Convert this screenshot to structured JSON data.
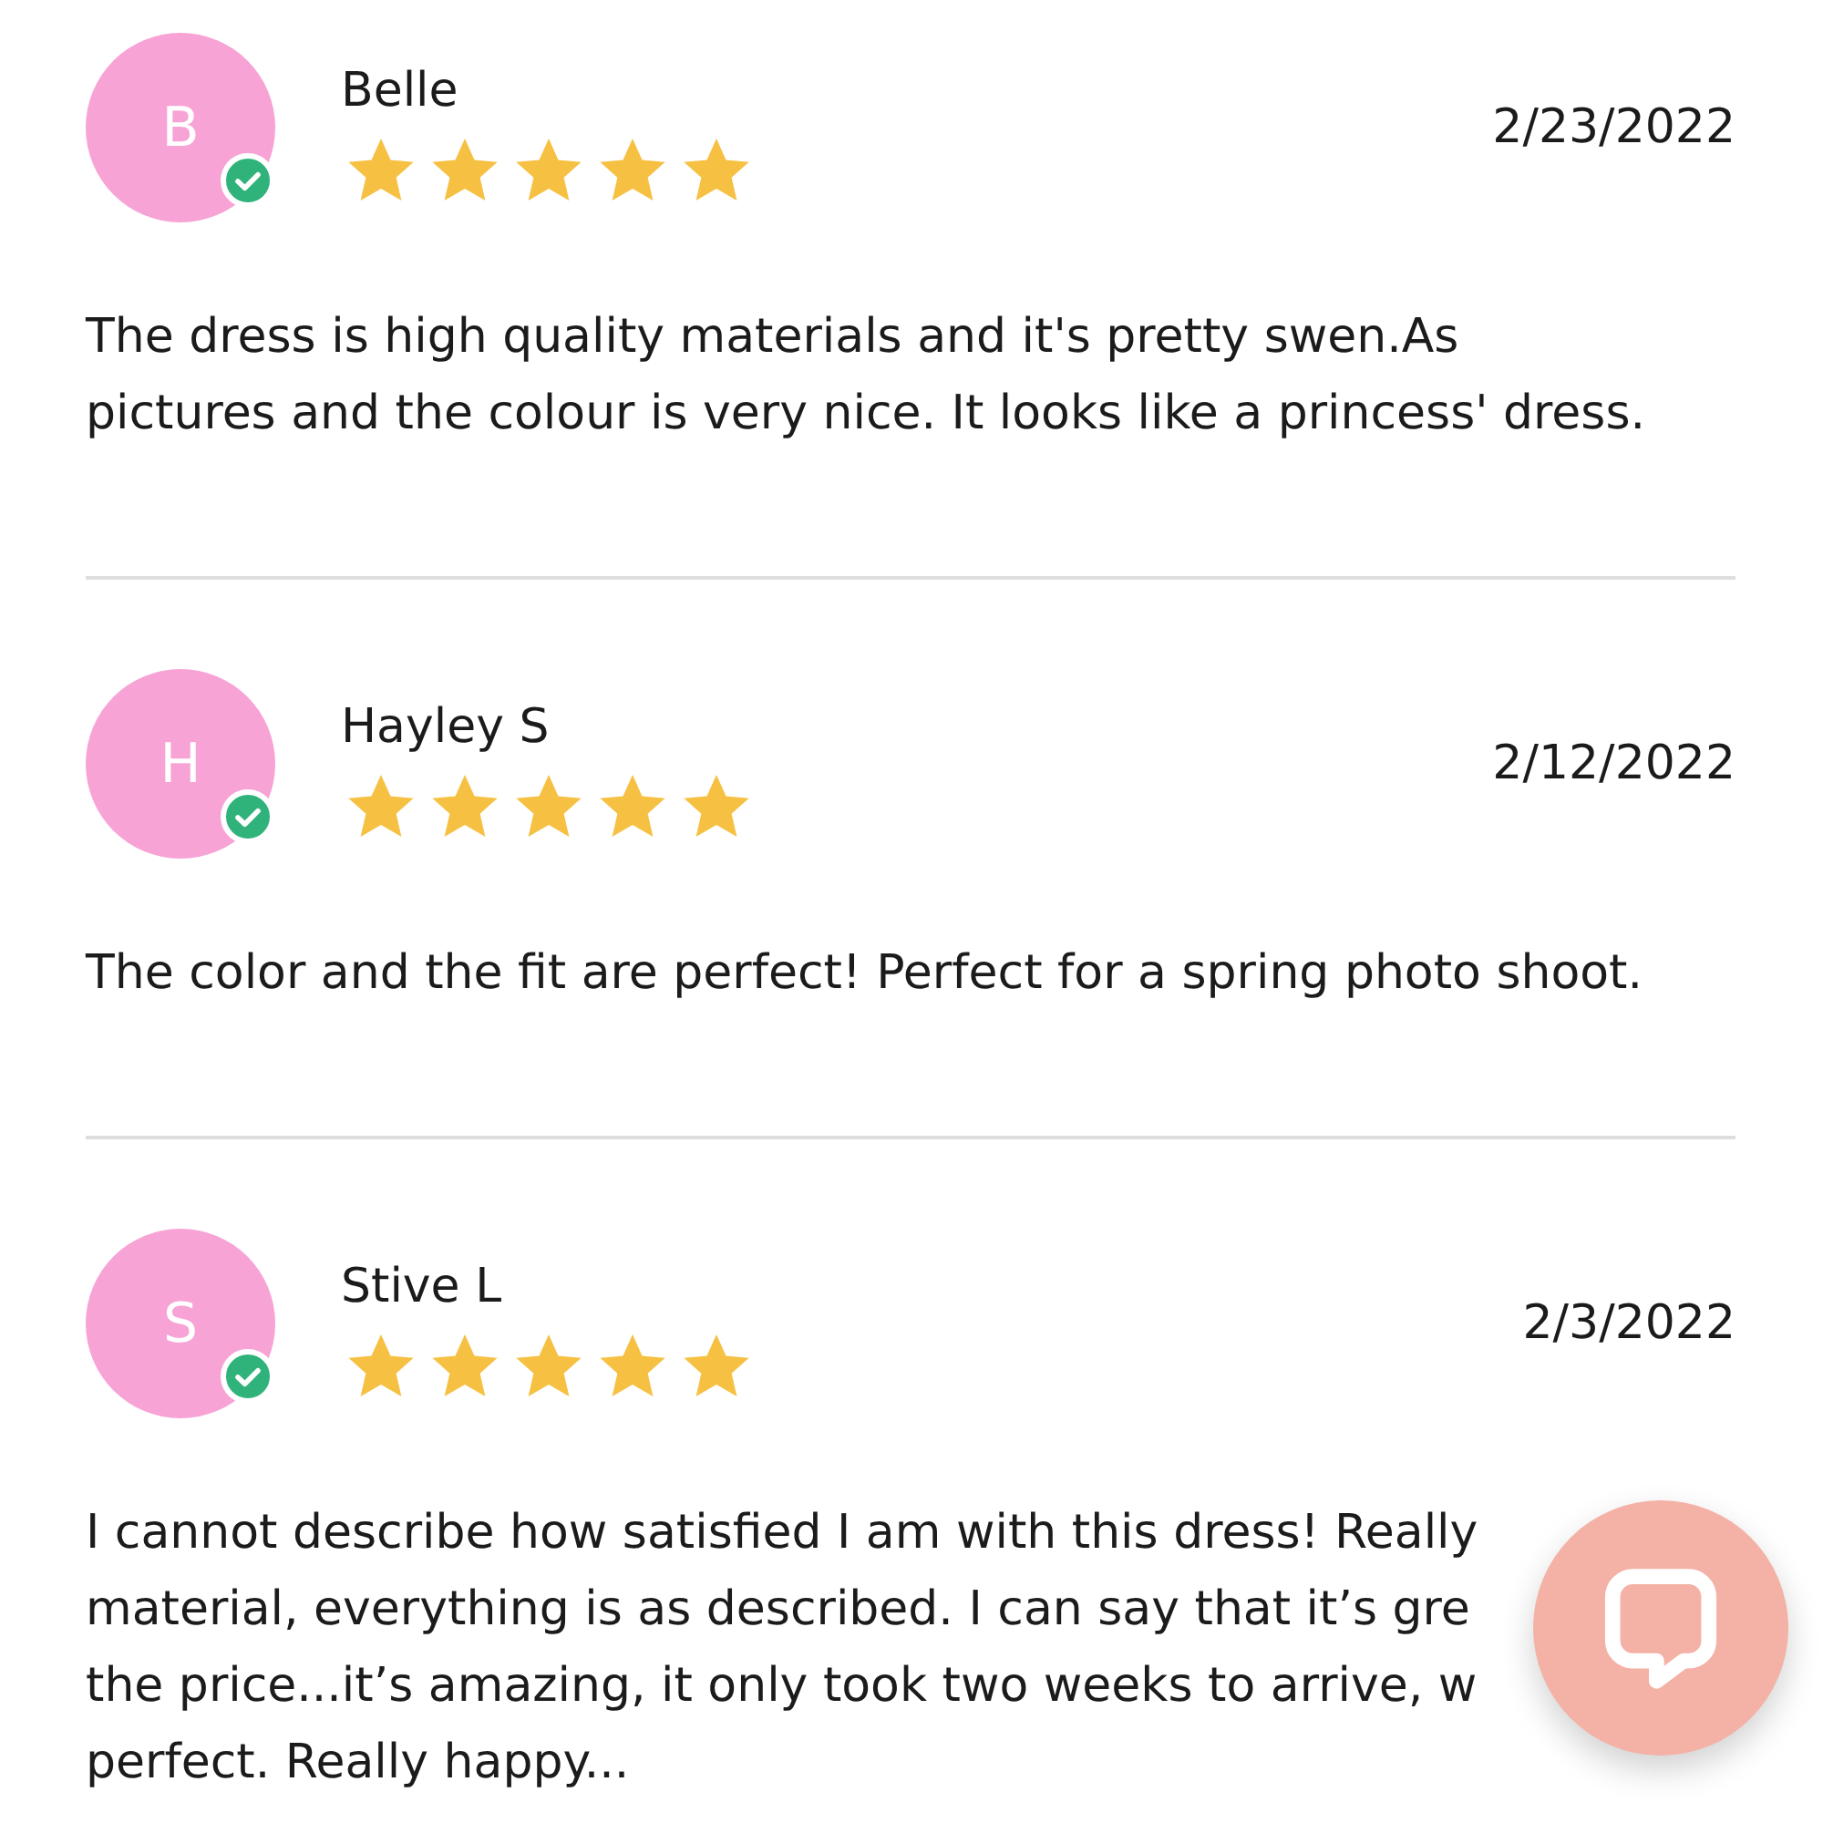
{
  "reviews": [
    {
      "initial": "B",
      "verified": true,
      "name": "Belle",
      "stars": 5,
      "date": "2/23/2022",
      "body_lines": [
        "The dress is high quality materials and it's pretty swen.As",
        "pictures and the colour is very nice. It looks like a princess' dress."
      ]
    },
    {
      "initial": "H",
      "verified": true,
      "name": "Hayley S",
      "stars": 5,
      "date": "2/12/2022",
      "body_lines": [
        "The color and the fit are perfect! Perfect for a spring photo shoot."
      ]
    },
    {
      "initial": "S",
      "verified": true,
      "name": "Stive L",
      "stars": 5,
      "date": "2/3/2022",
      "body_lines": [
        "I cannot describe how satisfied I am with this dress! Really",
        "material, everything is as described. I can say that it’s gre",
        "the price...it’s amazing, it only took two weeks to arrive, w",
        "perfect. Really happy..."
      ]
    }
  ]
}
